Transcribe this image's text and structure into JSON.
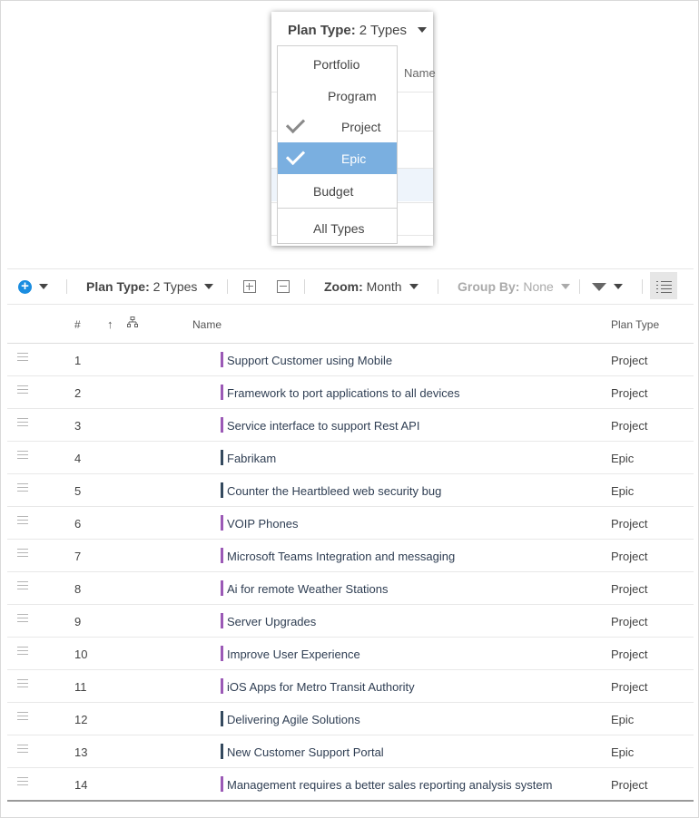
{
  "popup": {
    "header_label": "Plan Type:",
    "header_value": "2 Types",
    "bg_column": "Name",
    "menu": [
      {
        "label": "Portfolio",
        "checked": false
      },
      {
        "label": "Program",
        "checked": false
      },
      {
        "label": "Project",
        "checked": true
      },
      {
        "label": "Epic",
        "checked": true,
        "selected": true
      },
      {
        "label": "Budget",
        "checked": false
      },
      {
        "label": "All Types",
        "checked": false
      }
    ]
  },
  "toolbar": {
    "plan_type_label": "Plan Type:",
    "plan_type_value": "2 Types",
    "zoom_label": "Zoom:",
    "zoom_value": "Month",
    "group_by_label": "Group By:",
    "group_by_value": "None"
  },
  "table": {
    "headers": {
      "num": "#",
      "name": "Name",
      "plan_type": "Plan Type"
    },
    "colors": {
      "Project": "#9b59b6",
      "Epic": "#34495e"
    },
    "rows": [
      {
        "num": "1",
        "name": "Support Customer using Mobile",
        "plan_type": "Project"
      },
      {
        "num": "2",
        "name": "Framework to port applications to all devices",
        "plan_type": "Project"
      },
      {
        "num": "3",
        "name": "Service interface to support Rest API",
        "plan_type": "Project"
      },
      {
        "num": "4",
        "name": "Fabrikam",
        "plan_type": "Epic"
      },
      {
        "num": "5",
        "name": "Counter the Heartbleed web security bug",
        "plan_type": "Epic"
      },
      {
        "num": "6",
        "name": "VOIP Phones",
        "plan_type": "Project"
      },
      {
        "num": "7",
        "name": "Microsoft Teams Integration and messaging",
        "plan_type": "Project"
      },
      {
        "num": "8",
        "name": "Ai for remote Weather Stations",
        "plan_type": "Project"
      },
      {
        "num": "9",
        "name": "Server Upgrades",
        "plan_type": "Project"
      },
      {
        "num": "10",
        "name": "Improve User Experience",
        "plan_type": "Project"
      },
      {
        "num": "11",
        "name": "iOS Apps for Metro Transit Authority",
        "plan_type": "Project"
      },
      {
        "num": "12",
        "name": "Delivering Agile Solutions",
        "plan_type": "Epic"
      },
      {
        "num": "13",
        "name": "New Customer Support Portal",
        "plan_type": "Epic"
      },
      {
        "num": "14",
        "name": "Management requires a better sales reporting analysis system",
        "plan_type": "Project"
      }
    ]
  }
}
